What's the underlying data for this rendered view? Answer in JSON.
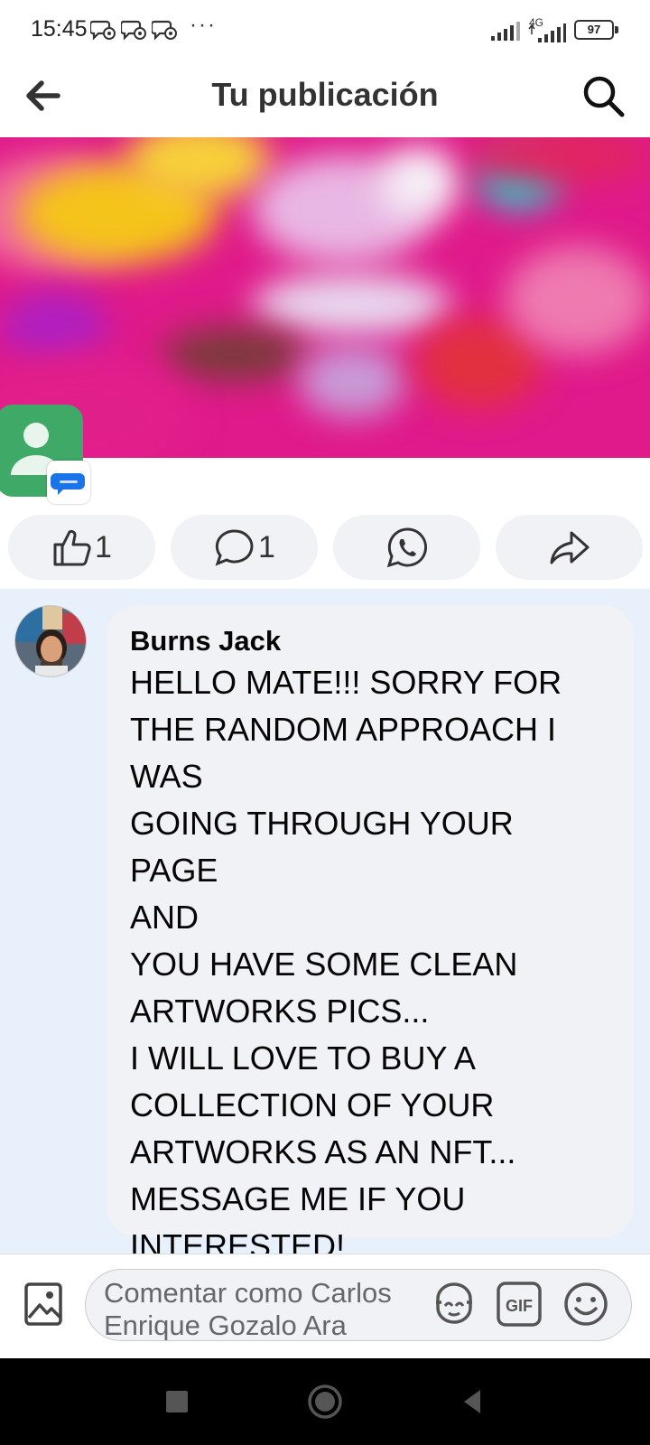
{
  "status_bar": {
    "time": "15:45",
    "more": "···",
    "network": "4G",
    "battery": "97"
  },
  "header": {
    "title": "Tu publicación"
  },
  "actions": {
    "like_count": "1",
    "comment_count": "1"
  },
  "comment": {
    "author": "Burns Jack",
    "text": "HELLO MATE!!! SORRY FOR\nTHE RANDOM APPROACH I\nWAS\nGOING THROUGH YOUR PAGE\nAND\nYOU HAVE SOME CLEAN\nARTWORKS PICS...\nI WILL LOVE TO BUY A\nCOLLECTION OF YOUR\nARTWORKS AS AN NFT...\nMESSAGE ME IF YOU\nINTERESTED!"
  },
  "composer": {
    "placeholder": "Comentar como Carlos Enrique Gozalo Ara"
  },
  "icons": [
    "back-arrow-icon",
    "search-icon",
    "like-icon",
    "comment-icon",
    "whatsapp-icon",
    "share-icon",
    "photo-icon",
    "avatar-sticker-icon",
    "gif-icon",
    "emoji-icon",
    "recents-icon",
    "home-icon",
    "back-icon"
  ],
  "colors": {
    "accent_blue": "#0866ff",
    "comment_highlight": "#e7f0fb",
    "bubble": "#f0f2f5"
  }
}
